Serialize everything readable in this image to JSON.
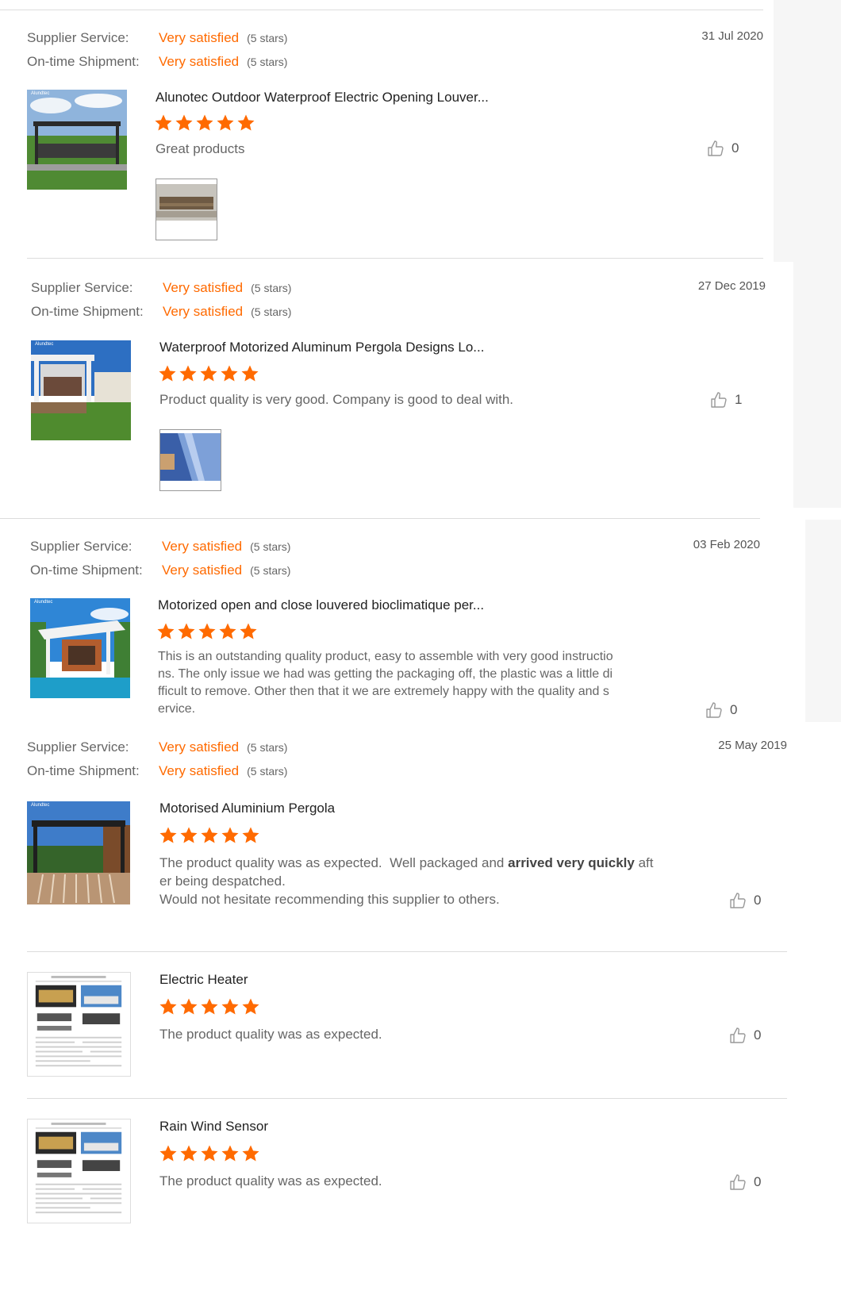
{
  "reviews": [
    {
      "supplier_service_label": "Supplier Service:",
      "supplier_service_value": "Very satisfied",
      "supplier_service_stars": "(5 stars)",
      "shipment_label": "On-time Shipment:",
      "shipment_value": "Very satisfied",
      "shipment_stars": "(5 stars)",
      "date": "31 Jul 2020",
      "title": "Alunotec Outdoor Waterproof Electric Opening Louver...",
      "comment": "Great products",
      "likes": "0"
    },
    {
      "supplier_service_label": "Supplier Service:",
      "supplier_service_value": "Very satisfied",
      "supplier_service_stars": "(5 stars)",
      "shipment_label": "On-time Shipment:",
      "shipment_value": "Very satisfied",
      "shipment_stars": "(5 stars)",
      "date": "27 Dec 2019",
      "title": "Waterproof Motorized Aluminum Pergola Designs Lo...",
      "comment": "Product quality is very good. Company is good to deal with.",
      "likes": "1"
    },
    {
      "supplier_service_label": "Supplier Service:",
      "supplier_service_value": "Very satisfied",
      "supplier_service_stars": "(5 stars)",
      "shipment_label": "On-time Shipment:",
      "shipment_value": "Very satisfied",
      "shipment_stars": "(5 stars)",
      "date": "03 Feb 2020",
      "title": "Motorized open and close louvered bioclimatique per...",
      "comment_lines": [
        "This is an outstanding quality product, easy to assemble with very good instructio",
        "ns.  The only issue we had was getting the packaging off, the plastic was a little di",
        "fficult to remove.  Other then that it we are extremely happy with the quality and s",
        "ervice."
      ],
      "likes": "0"
    },
    {
      "supplier_service_label": "Supplier Service:",
      "supplier_service_value": "Very satisfied",
      "supplier_service_stars": "(5 stars)",
      "shipment_label": "On-time Shipment:",
      "shipment_value": "Very satisfied",
      "shipment_stars": "(5 stars)",
      "date": "25 May 2019",
      "title": "Motorised Aluminium Pergola",
      "comment_part1": "The product quality was as expected.  Well packaged and ",
      "comment_bold": "arrived very quickly",
      "comment_part2": " aft",
      "comment_line2": "er being despatched.",
      "comment_line3": "Would not hesitate recommending this supplier to others.",
      "likes": "0"
    },
    {
      "title": "Electric Heater",
      "comment": "The product quality was as expected.",
      "likes": "0"
    },
    {
      "title": "Rain Wind Sensor",
      "comment": "The product quality was as expected.",
      "likes": "0"
    }
  ],
  "rating": "5",
  "logo_text": "Alundtec",
  "colors": {
    "accent": "#ff6a00",
    "divider": "#dcdcdc"
  }
}
